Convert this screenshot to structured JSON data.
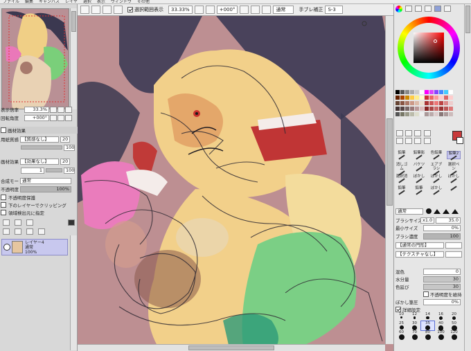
{
  "menu": [
    "ファイル",
    "編集",
    "キャンバス",
    "レイヤ",
    "選択",
    "表示",
    "ウィンドウ",
    "その他"
  ],
  "toolbar": {
    "show_selection_label": "選択範囲表示",
    "zoom": "33.33%",
    "rotation": "+000°",
    "blend": "通常",
    "stabilizer_label": "手ブレ補正",
    "stabilizer_value": "S-3"
  },
  "navigator": {
    "zoom_label": "表示倍率",
    "zoom_value": "33.3%",
    "angle_label": "回転角度",
    "angle_value": "+000°"
  },
  "paper_effect": {
    "title": "画材効果",
    "texture_label": "用紙質感",
    "texture_value": "【質感なし】",
    "texture_num": "20",
    "brush_label": "画材効果",
    "brush_value": "【効果なし】",
    "brush_num": "20",
    "sub_num": "1",
    "sub_num2": "100"
  },
  "layer_panel": {
    "blend_label": "合成モード",
    "blend_value": "通常",
    "opacity_label": "不透明度",
    "opacity_value": "100%",
    "opt1": "不透明度保護",
    "opt2": "下のレイヤーでクリッピング",
    "opt3": "領域検出元に指定"
  },
  "layer": {
    "name": "レイヤー4",
    "mode": "通常",
    "opacity": "100%"
  },
  "tools": [
    [
      "鉛筆",
      "鉛筆影",
      "色鉛筆",
      "鉛筆2"
    ],
    [
      "消しゴム",
      "バケツ",
      "エアブラシ",
      "選択ペン"
    ],
    [
      "選択消",
      "ぼかし",
      "ぼかし",
      "ぼかし"
    ],
    [
      "鉛筆",
      "鉛筆",
      "ぼかし",
      ""
    ]
  ],
  "brush": {
    "shape_label": "通常",
    "size_label": "ブラシサイズ",
    "size_mult": "x1.0",
    "size_value": "35.0",
    "min_label": "最小サイズ",
    "min_value": "0%",
    "density_label": "ブラシ濃度",
    "density_value": "100",
    "shape1": "【通常の円形】",
    "shape2": "【テクスチャなし】",
    "blend_label": "混色",
    "blend_value": "0",
    "water_label": "水分量",
    "water_value": "30",
    "stretch_label": "色延び",
    "stretch_value": "30",
    "keep_label": "不透明度を維持",
    "blur_label": "ぼかし筆圧",
    "blur_value": "0%",
    "detail_label": "詳細設定"
  },
  "brush_sizes": [
    "10",
    "12",
    "14",
    "16",
    "20",
    "25",
    "30",
    "35",
    "40",
    "50",
    "60",
    "70",
    "80",
    "100",
    "120"
  ],
  "colors": {
    "current": "#c8393a",
    "accent": "#c8c8ee"
  }
}
